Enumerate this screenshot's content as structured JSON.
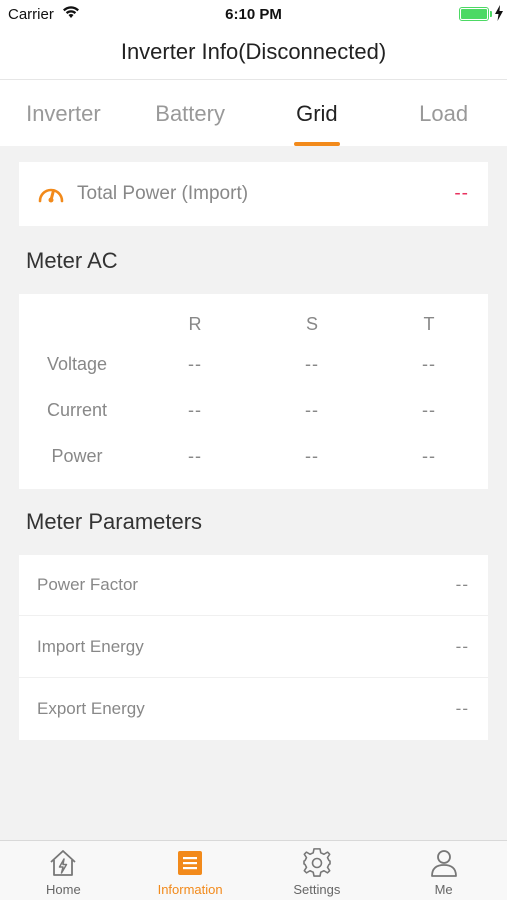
{
  "status_bar": {
    "carrier": "Carrier",
    "time": "6:10 PM"
  },
  "nav": {
    "title": "Inverter Info(Disconnected)"
  },
  "tabs": [
    {
      "label": "Inverter",
      "active": false
    },
    {
      "label": "Battery",
      "active": false
    },
    {
      "label": "Grid",
      "active": true
    },
    {
      "label": "Load",
      "active": false
    }
  ],
  "total_power": {
    "label": "Total Power (Import)",
    "value": "--"
  },
  "meter_ac": {
    "title": "Meter AC",
    "columns": [
      "R",
      "S",
      "T"
    ],
    "rows": [
      {
        "label": "Voltage",
        "values": [
          "--",
          "--",
          "--"
        ]
      },
      {
        "label": "Current",
        "values": [
          "--",
          "--",
          "--"
        ]
      },
      {
        "label": "Power",
        "values": [
          "--",
          "--",
          "--"
        ]
      }
    ]
  },
  "meter_parameters": {
    "title": "Meter Parameters",
    "rows": [
      {
        "label": "Power Factor",
        "value": "--"
      },
      {
        "label": "Import Energy",
        "value": "--"
      },
      {
        "label": "Export Energy",
        "value": "--"
      }
    ]
  },
  "tabbar": [
    {
      "label": "Home",
      "icon": "home-icon",
      "active": false
    },
    {
      "label": "Information",
      "icon": "information-icon",
      "active": true
    },
    {
      "label": "Settings",
      "icon": "gear-icon",
      "active": false
    },
    {
      "label": "Me",
      "icon": "user-icon",
      "active": false
    }
  ],
  "colors": {
    "accent": "#f28a1b",
    "alert": "#e8325f",
    "battery": "#4cd964"
  }
}
